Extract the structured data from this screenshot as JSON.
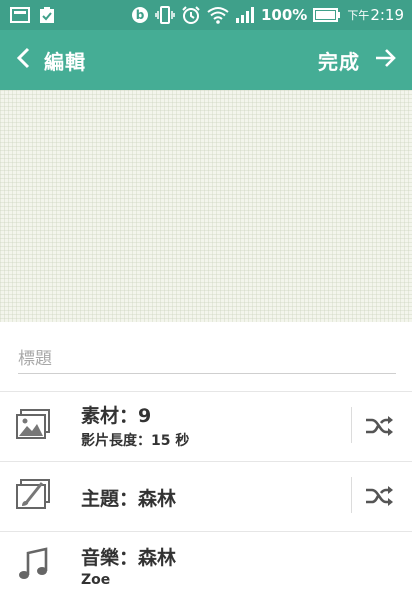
{
  "status_bar": {
    "battery_percent": "100%",
    "time_prefix": "下午",
    "time": "2:19",
    "icons": [
      "image-icon",
      "clipboard-check-icon",
      "beats-icon",
      "vibrate-icon",
      "alarm-icon",
      "wifi-icon",
      "signal-icon",
      "battery-icon"
    ]
  },
  "header": {
    "title": "編輯",
    "done_label": "完成",
    "color": "#45ad95"
  },
  "title_field": {
    "placeholder": "標題"
  },
  "rows": [
    {
      "main": "素材：9",
      "sub": "影片長度：15 秒",
      "icon": "photo-icon",
      "action_icon": "shuffle-icon"
    },
    {
      "main": "主題：森林",
      "sub": "",
      "icon": "brush-icon",
      "action_icon": "shuffle-icon"
    },
    {
      "main": "音樂：森林",
      "sub": "Zoe",
      "icon": "music-note-icon"
    }
  ]
}
